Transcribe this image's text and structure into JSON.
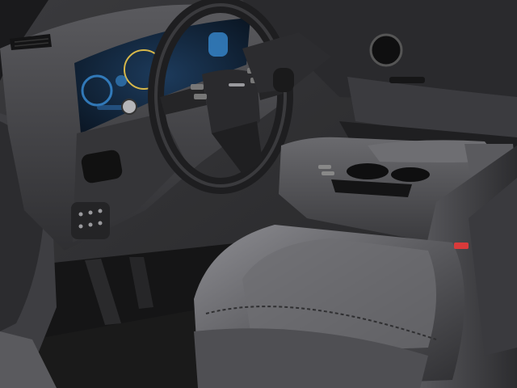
{
  "scene": {
    "subject": "car-interior-driver-side",
    "palette": {
      "upholstery": "#4a4a4d",
      "upholstery_highlight": "#8a8a8e",
      "dashboard": "#2b2b2e",
      "door_panel": "#303033",
      "floor": "#151516",
      "display_glow": "#3a8fd8",
      "display_ring": "#d8b84a",
      "accent_red": "#d83a3a"
    }
  }
}
